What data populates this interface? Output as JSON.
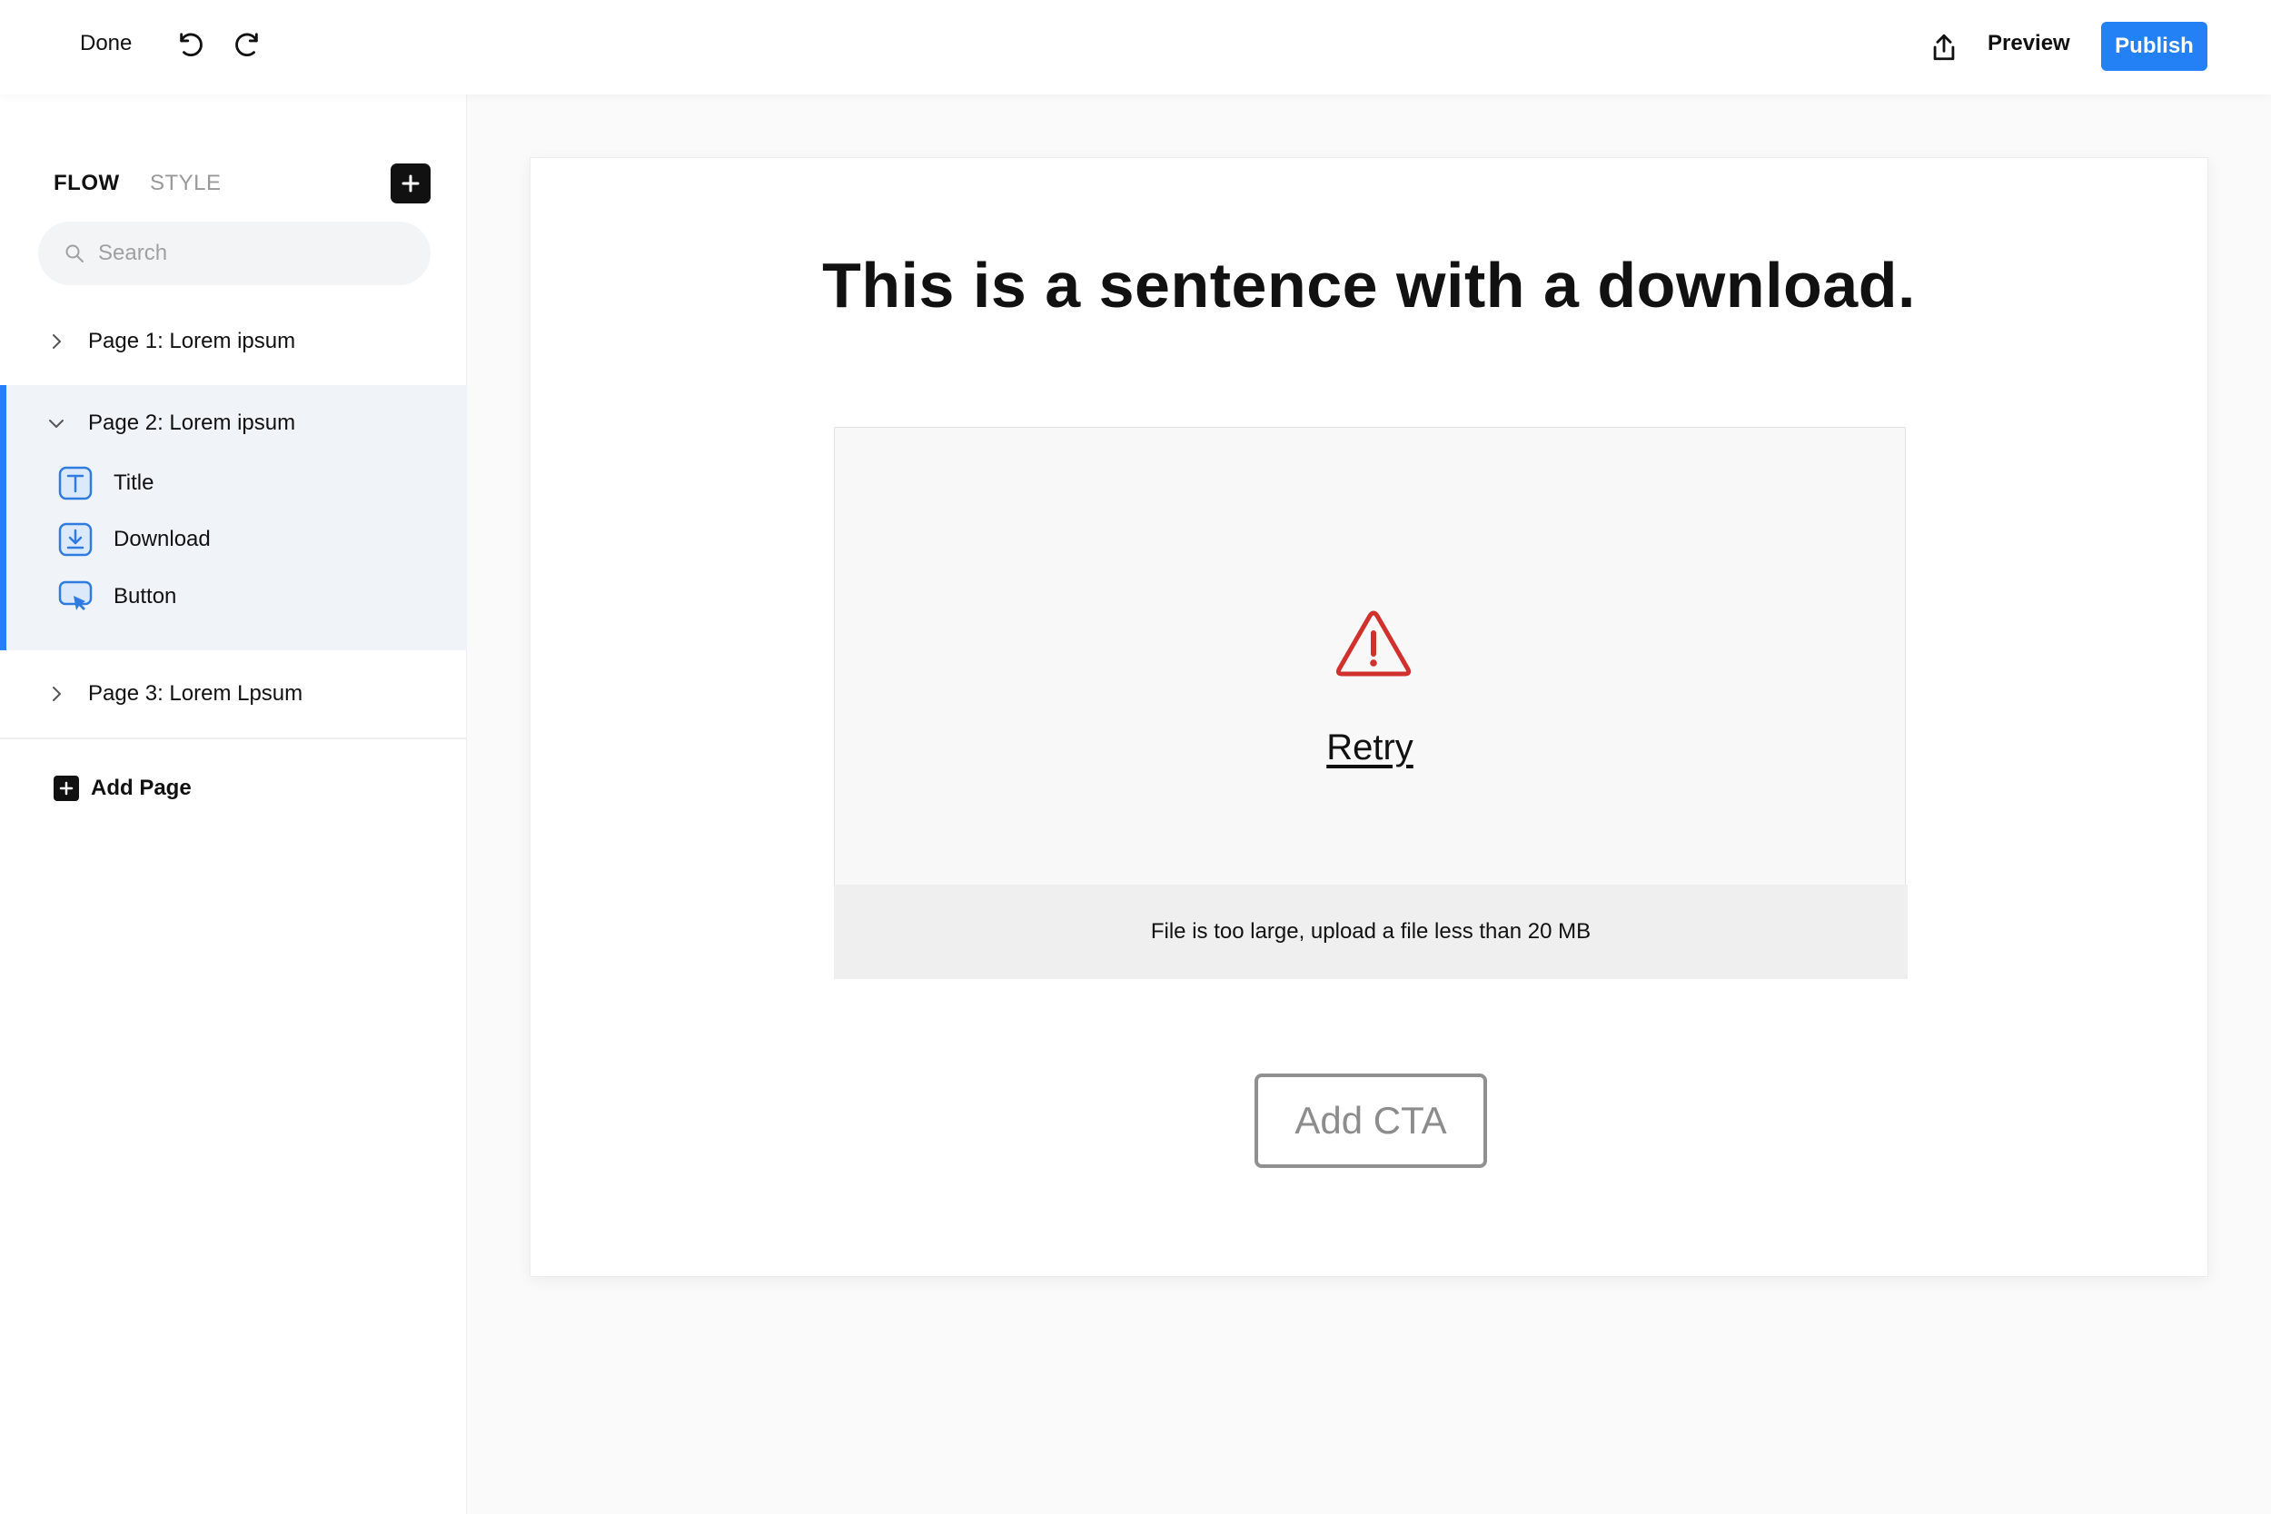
{
  "topbar": {
    "done_label": "Done",
    "preview_label": "Preview",
    "publish_label": "Publish",
    "accent_color": "#2481f5"
  },
  "sidebar": {
    "tabs": [
      {
        "label": "FLOW",
        "active": true
      },
      {
        "label": "STYLE",
        "active": false
      }
    ],
    "search": {
      "placeholder": "Search",
      "value": ""
    },
    "pages": [
      {
        "label": "Page 1: Lorem ipsum",
        "expanded": false
      },
      {
        "label": "Page 2: Lorem ipsum",
        "expanded": true,
        "selected": true,
        "children": [
          {
            "label": "Title",
            "icon": "text-icon"
          },
          {
            "label": "Download",
            "icon": "download-icon"
          },
          {
            "label": "Button",
            "icon": "button-cursor-icon"
          }
        ]
      },
      {
        "label": "Page 3: Lorem Lpsum",
        "expanded": false
      }
    ],
    "add_page_label": "Add Page"
  },
  "canvas": {
    "headline": "This is a sentence with a download.",
    "download": {
      "retry_label": "Retry",
      "error_message": "File is too large, upload a file less than 20 MB",
      "error_color": "#d0312d"
    },
    "cta_label": "Add CTA"
  }
}
